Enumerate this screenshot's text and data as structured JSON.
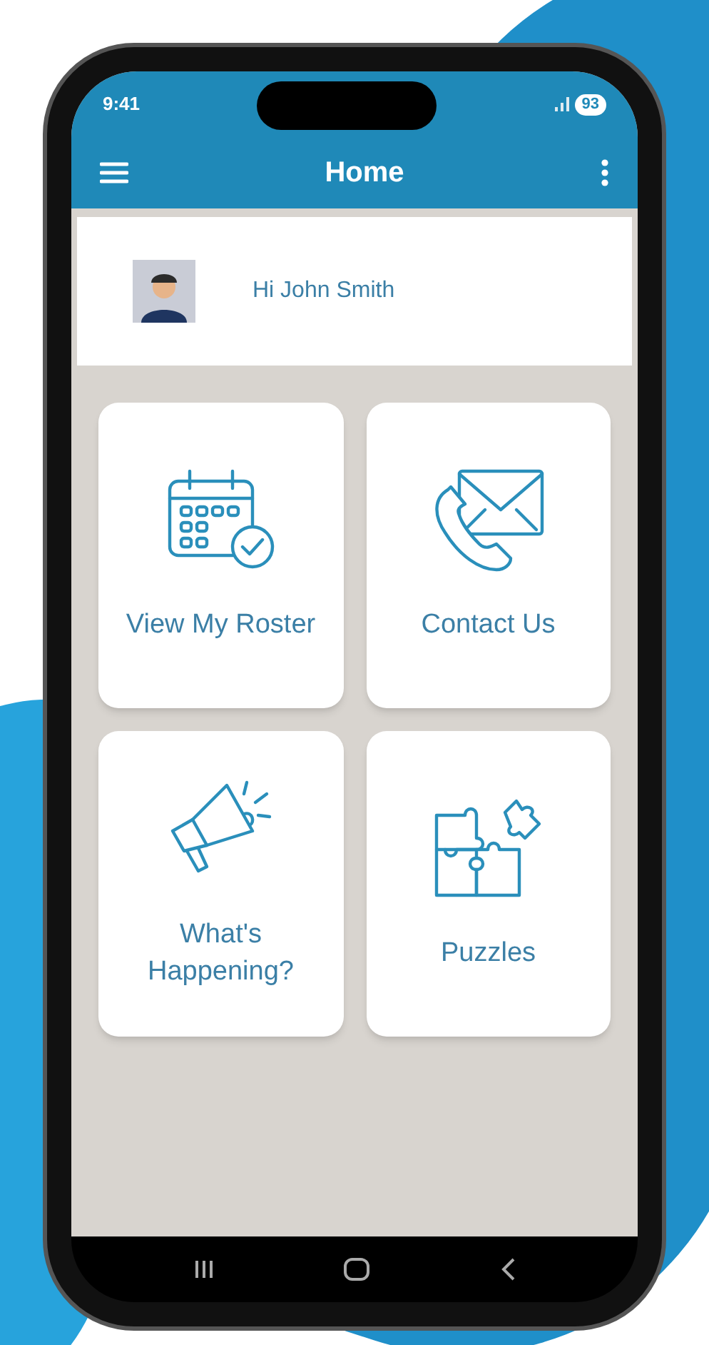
{
  "status_bar": {
    "time": "9:41",
    "battery": "93"
  },
  "app_bar": {
    "title": "Home"
  },
  "greeting": {
    "text": "Hi John Smith"
  },
  "tiles": [
    {
      "kind": "calendar",
      "label": "View My Roster"
    },
    {
      "kind": "contact",
      "label": "Contact Us"
    },
    {
      "kind": "megaphone",
      "label": "What's Happening?"
    },
    {
      "kind": "puzzle",
      "label": "Puzzles"
    }
  ]
}
